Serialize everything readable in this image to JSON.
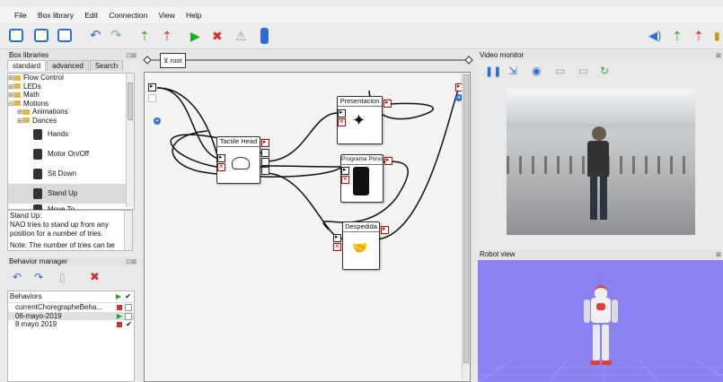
{
  "menu": [
    "File",
    "Box library",
    "Edit",
    "Connection",
    "View",
    "Help"
  ],
  "box_libraries": {
    "title": "Box libraries",
    "tabs": [
      "standard",
      "advanced",
      "Search"
    ],
    "tree": [
      "Flow Control",
      "LEDs",
      "Math",
      "Motions",
      "Animations",
      "Dances"
    ],
    "items": [
      "Hands",
      "Motor On/Off",
      "Sit Down",
      "Stand Up",
      "Move To"
    ],
    "selected_item": "Stand Up",
    "description": {
      "heading": "Stand Up:",
      "text": "NAO tries to stand up from any position for a number of tries.",
      "note": "Note: The number of tries can be"
    }
  },
  "behavior_manager": {
    "title": "Behavior manager",
    "list_header": "Behaviors",
    "behaviors": [
      "currentChoregrapheBeha...",
      "06-mayo-2019",
      "8 mayo 2019"
    ]
  },
  "flow": {
    "breadcrumb": "root",
    "boxes": {
      "tactile": "Tactile Head",
      "presentacion": "Presentacion",
      "programa": "Programa Principi",
      "despedida": "Despedida"
    }
  },
  "video_monitor": {
    "title": "Video monitor"
  },
  "robot_view": {
    "title": "Robot view"
  },
  "colors": {
    "accent": "#2d6fd1",
    "robot_bg": "#8a82f2",
    "alert": "#d03030",
    "play": "#22aa22"
  }
}
